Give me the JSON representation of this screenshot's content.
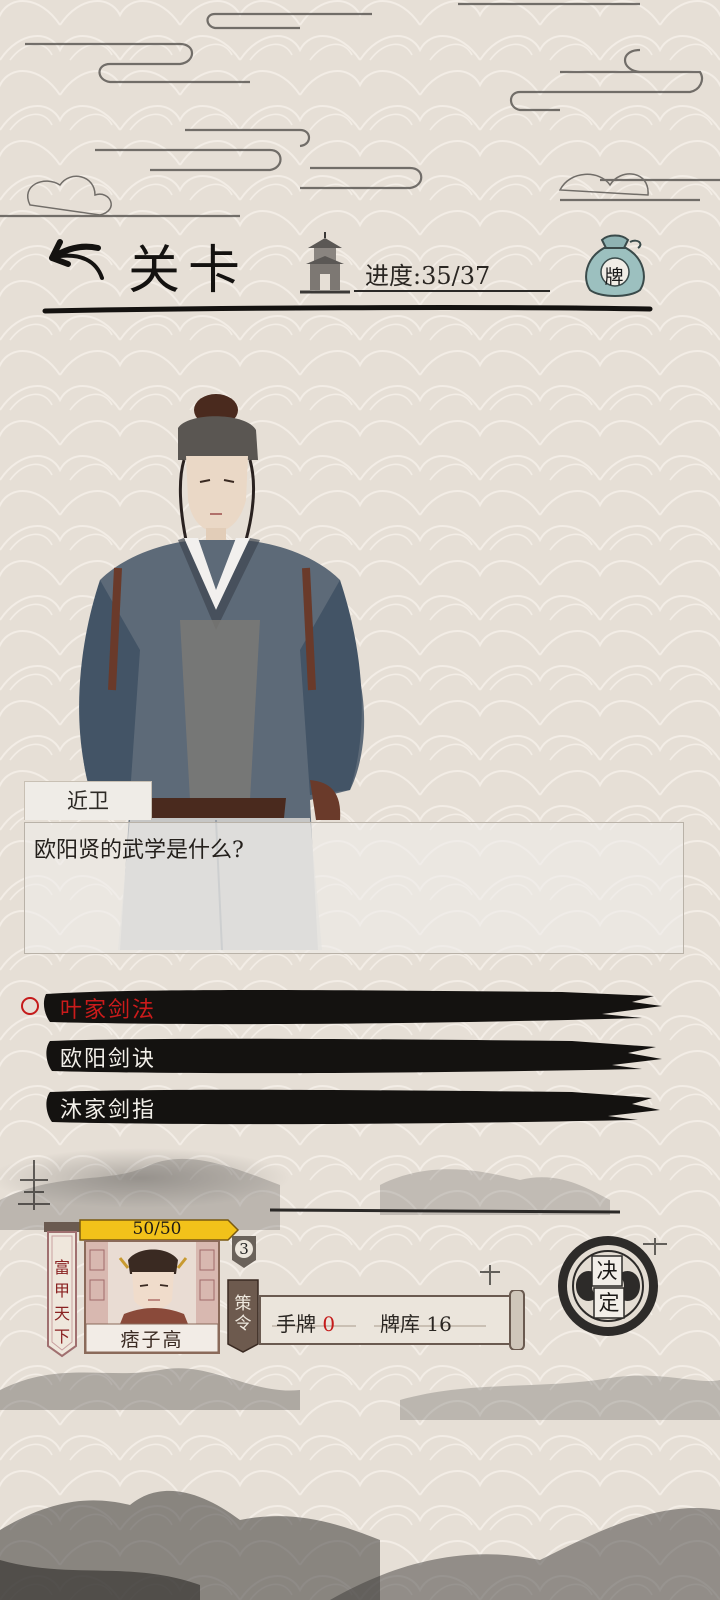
{
  "header": {
    "title": "关卡",
    "progress_label": "进度:",
    "progress_value": "35/37",
    "bag_label": "牌"
  },
  "dialog": {
    "speaker": "近卫",
    "text": "欧阳贤的武学是什么?"
  },
  "options": [
    {
      "label": "叶家剑法",
      "selected": true
    },
    {
      "label": "欧阳剑诀",
      "selected": false
    },
    {
      "label": "沐家剑指",
      "selected": false
    }
  ],
  "player": {
    "hp_text": "50/50",
    "hp_fraction": 1.0,
    "title_banner": "富甲天下",
    "name": "痞子高",
    "cost": "3",
    "strategy_label": "策令",
    "hand_label": "手牌",
    "hand_count": "0",
    "deck_label": "牌库",
    "deck_count": "16"
  },
  "decide_button": {
    "label_top": "决",
    "label_bottom": "定"
  },
  "colors": {
    "accent_red": "#c51b1b",
    "ink": "#141210",
    "paper": "#e8e1d8",
    "hp_yellow": "#f2c21a"
  }
}
